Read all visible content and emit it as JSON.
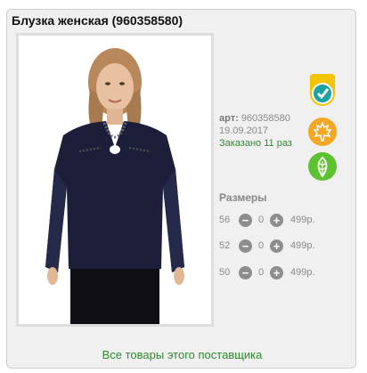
{
  "product": {
    "title": "Блузка женская (960358580)",
    "article_label": "арт:",
    "article_value": "960358580",
    "date": "19.09.2017",
    "ordered": "Заказано 11 раз"
  },
  "badges": [
    {
      "name": "check",
      "color": "#1aa3a3"
    },
    {
      "name": "maple-leaf",
      "color": "#f5a623"
    },
    {
      "name": "leaf",
      "color": "#5cc22f"
    }
  ],
  "sizes_title": "Размеры",
  "sizes": [
    {
      "size": "56",
      "qty": "0",
      "price": "499р."
    },
    {
      "size": "52",
      "qty": "0",
      "price": "499р."
    },
    {
      "size": "50",
      "qty": "0",
      "price": "499р."
    }
  ],
  "supplier_link": "Все товары этого поставщика"
}
